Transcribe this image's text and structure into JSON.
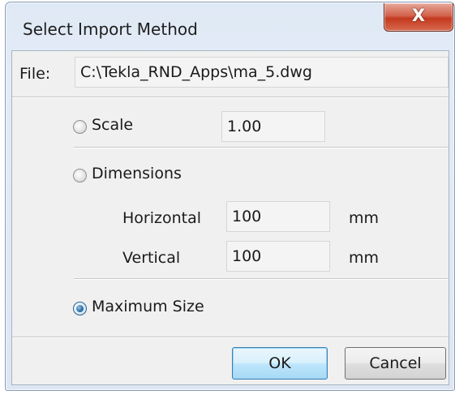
{
  "window": {
    "title": "Select Import Method",
    "close_glyph": "X"
  },
  "file": {
    "label": "File:",
    "path": "C:\\Tekla_RND_Apps\\ma_5.dwg"
  },
  "scale": {
    "label": "Scale",
    "value": "1.00",
    "checked": false
  },
  "dimensions": {
    "label": "Dimensions",
    "checked": false,
    "horizontal_label": "Horizontal",
    "horizontal_value": "100",
    "horizontal_unit": "mm",
    "vertical_label": "Vertical",
    "vertical_value": "100",
    "vertical_unit": "mm"
  },
  "maximum_size": {
    "label": "Maximum Size",
    "checked": true
  },
  "buttons": {
    "ok": "OK",
    "cancel": "Cancel"
  }
}
